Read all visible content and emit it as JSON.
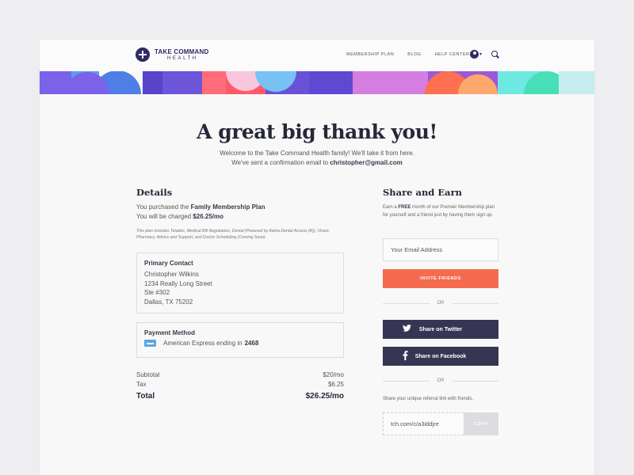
{
  "brand": {
    "line1": "TAKE COMMAND",
    "line2": "HEALTH"
  },
  "nav": {
    "links": [
      "MEMBERSHIP PLAN",
      "BLOG",
      "HELP CENTER"
    ]
  },
  "hero": {
    "title": "A great big thank you!",
    "line1": "Welcome to the Take Command Health family! We'll take it from here.",
    "line2_prefix": "We've sent a confirmation email to ",
    "email": "christopher@gmail.com"
  },
  "details": {
    "heading": "Details",
    "purchased_prefix": "You purchased the ",
    "plan": "Family Membership Plan",
    "charged_prefix": "You will be charged ",
    "charge": "$26.25/mo",
    "fine_print": "This plan includes Teladoc, Medical Bill Negotiation, Dental (Powered by Aetna Dental Access (R)), Vision, Pharmacy, Advice and Support, and Doctor Scheduling (Coming Soon)"
  },
  "contact": {
    "title": "Primary Contact",
    "lines": [
      "Christopher Wilkins",
      "1234 Really Long Street",
      "Ste #302",
      "Dallas, TX 75202"
    ]
  },
  "payment": {
    "title": "Payment Method",
    "card_prefix": "American Express ending in",
    "last4": "2468"
  },
  "totals": {
    "subtotal_label": "Subtotal",
    "subtotal": "$20/mo",
    "tax_label": "Tax",
    "tax": "$6.25",
    "total_label": "Total",
    "total": "$26.25/mo"
  },
  "share": {
    "heading": "Share and Earn",
    "text_prefix": "Earn a ",
    "free": "FREE",
    "text_suffix": " month of our Premier Membership plan for yourself and a friend just by having them sign up.",
    "email_placeholder": "Your Email Address",
    "invite_label": "INVITE FRIENDS",
    "or1": "OR",
    "twitter_label": "Share on Twitter",
    "facebook_label": "Share on Facebook",
    "or2": "OR",
    "referral_text": "Share your unique referral link with friends.",
    "referral_link": "tch.com/c/a3iddjre",
    "copy_label": "COPY"
  },
  "colors": {
    "accent": "#f46b4f",
    "brand": "#2e2a64",
    "social": "#363553"
  }
}
